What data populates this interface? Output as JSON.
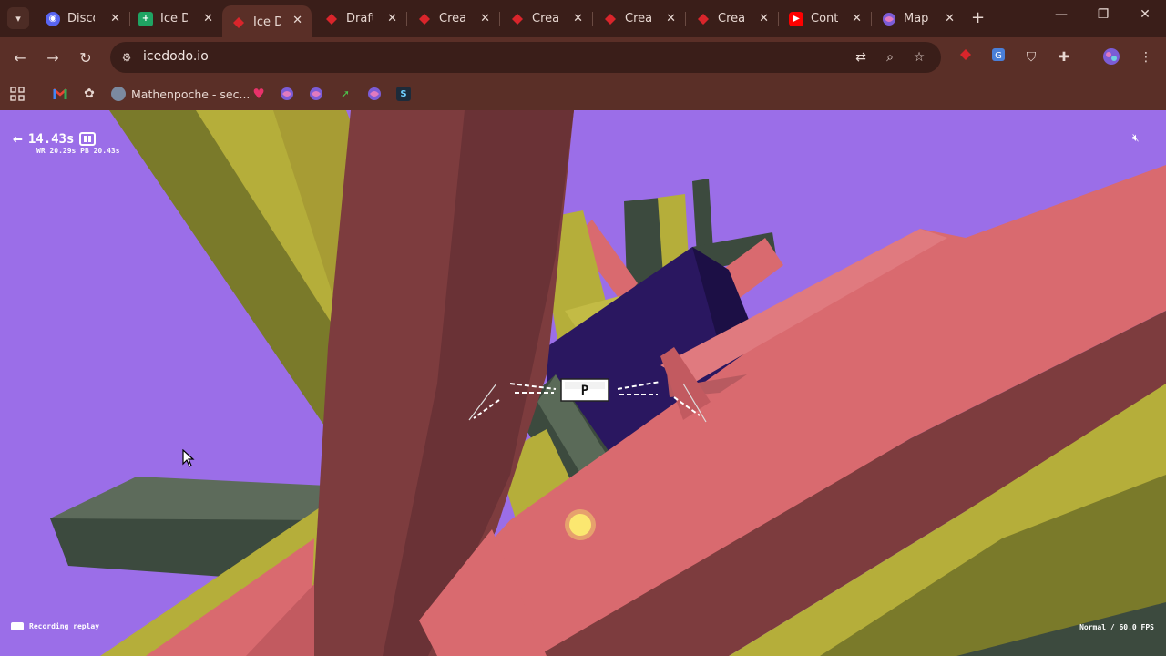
{
  "browser": {
    "tabs": [
      {
        "title": "Discor",
        "favicon": "discord-icon",
        "color": "#5865f2",
        "active": false
      },
      {
        "title": "Ice Do",
        "favicon": "sheets-plus-icon",
        "color": "#1fa463",
        "active": false
      },
      {
        "title": "Ice Do",
        "favicon": "red-diamond-icon",
        "color": "#d9252b",
        "active": true
      },
      {
        "title": "Drafts",
        "favicon": "red-diamond-icon",
        "color": "#d9252b",
        "active": false
      },
      {
        "title": "Creati",
        "favicon": "red-diamond-icon",
        "color": "#d9252b",
        "active": false
      },
      {
        "title": "Creati",
        "favicon": "red-diamond-icon",
        "color": "#d9252b",
        "active": false
      },
      {
        "title": "Creati",
        "favicon": "red-diamond-icon",
        "color": "#d9252b",
        "active": false
      },
      {
        "title": "Creati",
        "favicon": "red-diamond-icon",
        "color": "#d9252b",
        "active": false
      },
      {
        "title": "Conte",
        "favicon": "youtube-icon",
        "color": "#ff0000",
        "active": false
      },
      {
        "title": "Map l",
        "favicon": "swirl-icon",
        "color": "#7b5cd6",
        "active": false
      }
    ],
    "url": "icedodo.io",
    "bookmarks": [
      {
        "label": "",
        "icon": "gmail-icon"
      },
      {
        "label": "",
        "icon": "openai-icon"
      },
      {
        "label": "Mathenpoche - sec...",
        "icon": "mathenpoche-icon"
      },
      {
        "label": "",
        "icon": "heart-icon"
      },
      {
        "label": "",
        "icon": "swirl-icon"
      },
      {
        "label": "",
        "icon": "swirl-icon"
      },
      {
        "label": "",
        "icon": "arrow-icon"
      },
      {
        "label": "",
        "icon": "swirl-icon"
      },
      {
        "label": "",
        "icon": "s-icon"
      }
    ]
  },
  "game": {
    "time": "14.43s",
    "records": "WR 20.29s PB 20.43s",
    "recording_label": "Recording replay",
    "mode_fps": "Normal / 60.0 FPS",
    "player_label": "P",
    "colors": {
      "sky": "#9b6ee8",
      "pink_beam": "#d96a6f",
      "maroon_beam": "#7d3c3e",
      "olive_beam": "#b5ae3a",
      "dark_green": "#3c4a3e",
      "navy_block": "#2a1760"
    }
  }
}
